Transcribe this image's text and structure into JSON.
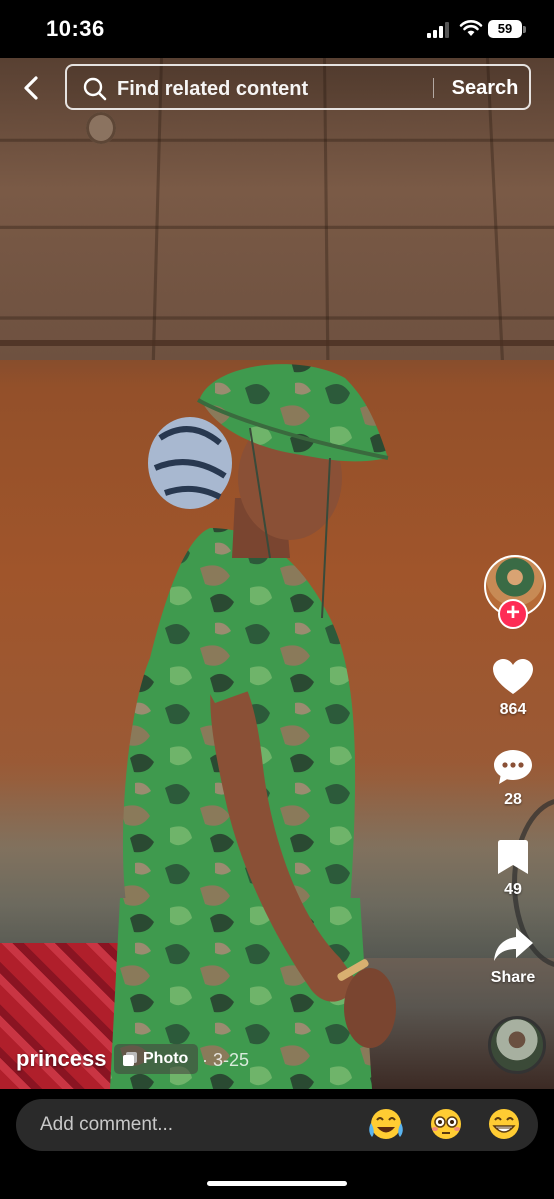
{
  "status_bar": {
    "time": "10:36",
    "battery": "59"
  },
  "header": {
    "search_placeholder": "Find related content",
    "search_label": "Search"
  },
  "actions": {
    "likes": "864",
    "comments": "28",
    "saves": "49",
    "share_label": "Share",
    "follow_symbol": "+"
  },
  "post": {
    "username": "princess",
    "type_label": "Photo",
    "date": "· 3-25"
  },
  "comment_bar": {
    "placeholder": "Add comment...",
    "emojis": [
      "😂",
      "😳",
      "😁"
    ]
  },
  "colors": {
    "accent": "#fe2c55",
    "background": "#000000"
  },
  "icons": [
    "back-arrow",
    "search",
    "heart",
    "comment-bubble",
    "bookmark",
    "share-arrow",
    "photo-stack"
  ]
}
